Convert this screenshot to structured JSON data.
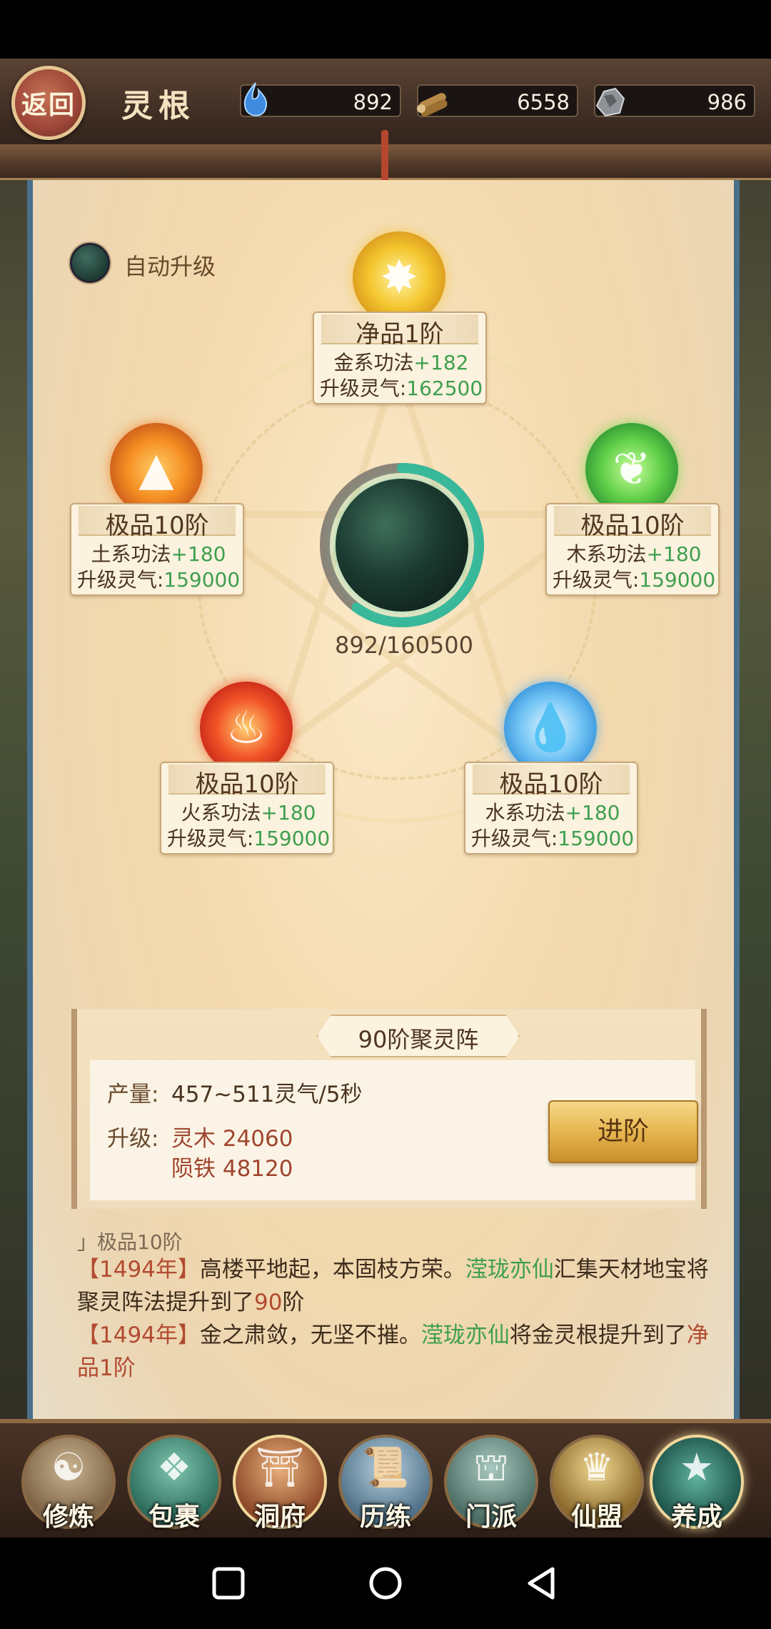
{
  "header": {
    "back_label": "返回",
    "title": "灵根",
    "resources": [
      {
        "icon": "spirit-energy-icon",
        "value": "892"
      },
      {
        "icon": "spirit-wood-icon",
        "value": "6558"
      },
      {
        "icon": "meteor-iron-icon",
        "value": "986"
      }
    ]
  },
  "auto_upgrade": {
    "label": "自动升级"
  },
  "core": {
    "progress_text": "892/160500",
    "progress_fraction": 0.0056
  },
  "elements": {
    "metal": {
      "grade": "净品1阶",
      "skill": "金系功法",
      "bonus": "+182",
      "cost_label": "升级灵气:",
      "cost": "162500"
    },
    "earth": {
      "grade": "极品10阶",
      "skill": "土系功法",
      "bonus": "+180",
      "cost_label": "升级灵气:",
      "cost": "159000"
    },
    "wood": {
      "grade": "极品10阶",
      "skill": "木系功法",
      "bonus": "+180",
      "cost_label": "升级灵气:",
      "cost": "159000"
    },
    "fire": {
      "grade": "极品10阶",
      "skill": "火系功法",
      "bonus": "+180",
      "cost_label": "升级灵气:",
      "cost": "159000"
    },
    "water": {
      "grade": "极品10阶",
      "skill": "水系功法",
      "bonus": "+180",
      "cost_label": "升级灵气:",
      "cost": "159000"
    }
  },
  "array": {
    "title": "90阶聚灵阵",
    "output_label": "产量:",
    "output_value": "457~511灵气/5秒",
    "upgrade_label": "升级:",
    "cost_wood": "灵木 24060",
    "cost_iron": "陨铁 48120",
    "advance_button": "进阶"
  },
  "log": {
    "faded_line": "」极品10阶",
    "entries": [
      {
        "year": "【1494年】",
        "text1": "高楼平地起，本固枝方荣。",
        "name": "滢珑亦仙",
        "text2": "汇集天材地宝将聚灵阵法提升到了",
        "highlight": "90",
        "text3": "阶"
      },
      {
        "year": "【1494年】",
        "text1": "金之肃敛，无坚不摧。",
        "name": "滢珑亦仙",
        "text2": "将金灵根提升到了",
        "highlight": "净品1阶",
        "text3": ""
      }
    ]
  },
  "bottom_nav": [
    {
      "label": "修炼",
      "icon": "cultivator-icon"
    },
    {
      "label": "包裹",
      "icon": "bag-icon"
    },
    {
      "label": "洞府",
      "icon": "cave-dwelling-icon"
    },
    {
      "label": "历练",
      "icon": "scroll-icon"
    },
    {
      "label": "门派",
      "icon": "sect-gate-icon"
    },
    {
      "label": "仙盟",
      "icon": "alliance-icon"
    },
    {
      "label": "养成",
      "icon": "pentagram-icon"
    }
  ],
  "colors": {
    "accent_green": "#3e9f4e",
    "accent_red": "#b24b31",
    "panel": "#f3d9ad"
  }
}
